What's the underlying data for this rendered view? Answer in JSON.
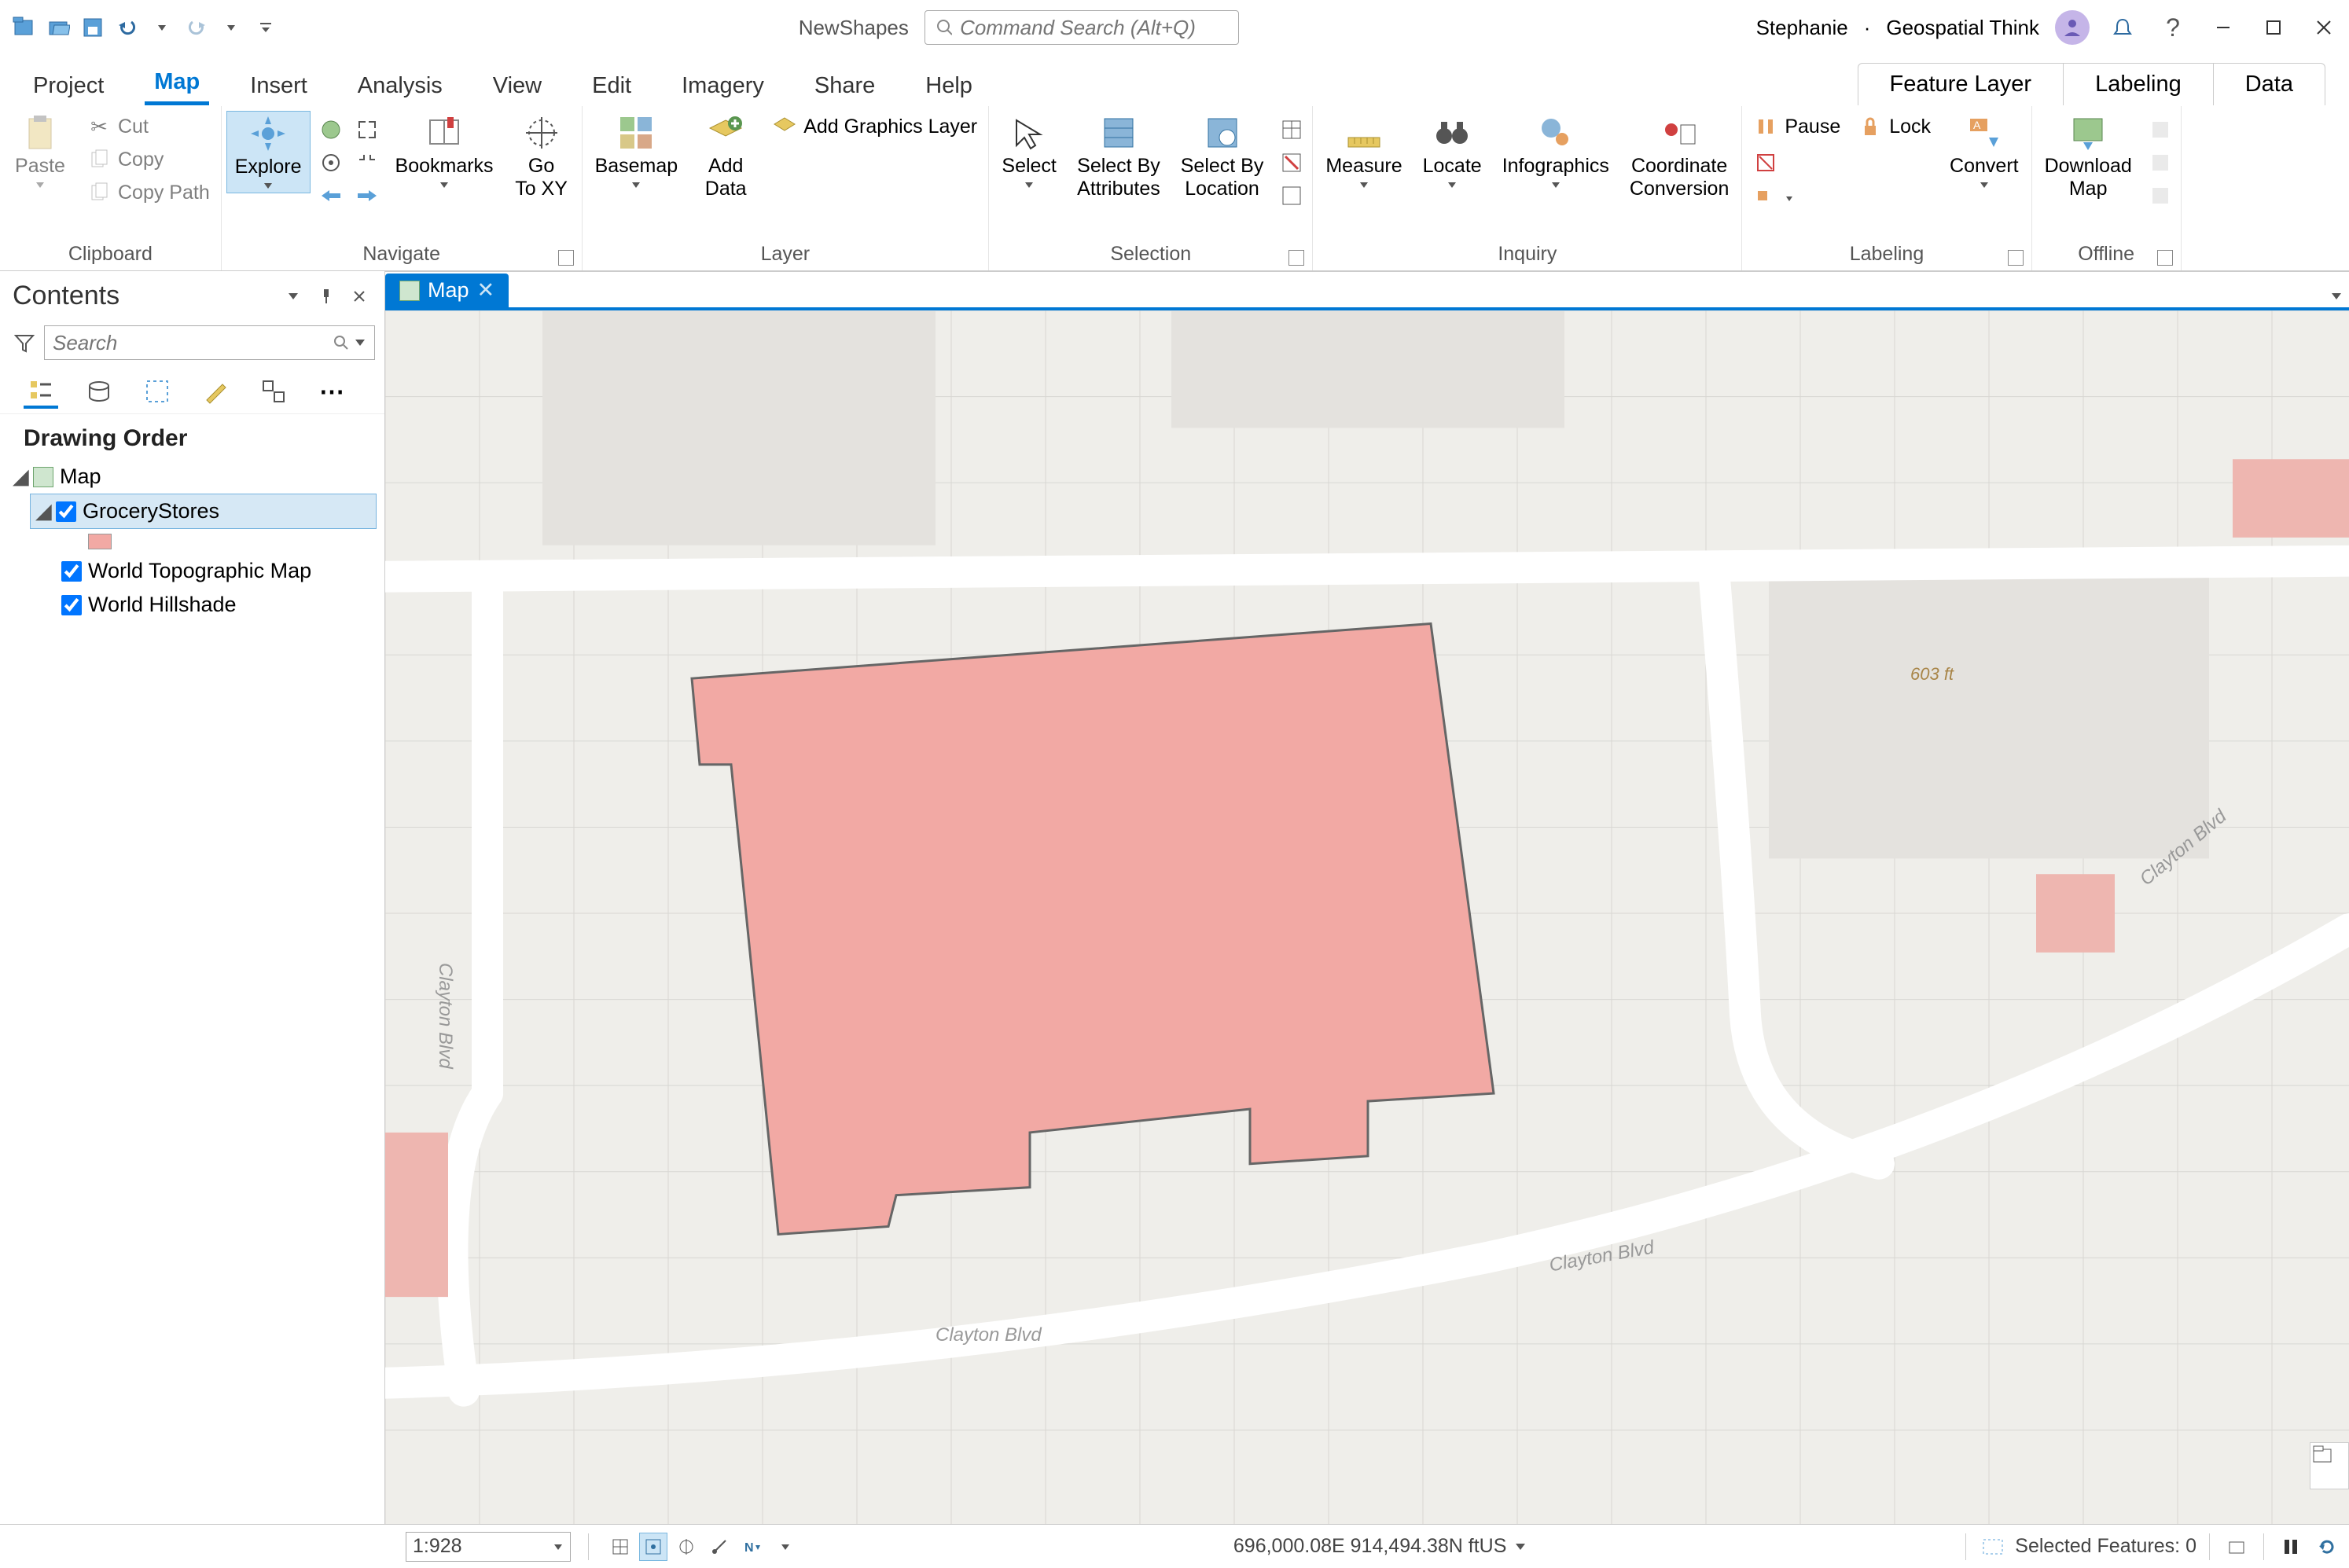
{
  "title_bar": {
    "project_name": "NewShapes",
    "command_search_placeholder": "Command Search (Alt+Q)",
    "user_name": "Stephanie",
    "org": "Geospatial Think"
  },
  "main_tabs": [
    "Project",
    "Map",
    "Insert",
    "Analysis",
    "View",
    "Edit",
    "Imagery",
    "Share",
    "Help"
  ],
  "active_main_tab": "Map",
  "context_tabs": [
    "Feature Layer",
    "Labeling",
    "Data"
  ],
  "ribbon": {
    "clipboard": {
      "title": "Clipboard",
      "paste": "Paste",
      "cut": "Cut",
      "copy": "Copy",
      "copy_path": "Copy Path"
    },
    "navigate": {
      "title": "Navigate",
      "explore": "Explore",
      "bookmarks": "Bookmarks",
      "goto_xy": "Go\nTo XY"
    },
    "layer": {
      "title": "Layer",
      "basemap": "Basemap",
      "add_data": "Add\nData",
      "add_graphics": "Add Graphics Layer"
    },
    "selection": {
      "title": "Selection",
      "select": "Select",
      "by_attr": "Select By\nAttributes",
      "by_loc": "Select By\nLocation"
    },
    "inquiry": {
      "title": "Inquiry",
      "measure": "Measure",
      "locate": "Locate",
      "infographics": "Infographics",
      "coord_conv": "Coordinate\nConversion"
    },
    "labeling": {
      "title": "Labeling",
      "pause": "Pause",
      "lock": "Lock",
      "convert": "Convert"
    },
    "offline": {
      "title": "Offline",
      "download_map": "Download\nMap"
    }
  },
  "contents": {
    "title": "Contents",
    "search_placeholder": "Search",
    "drawing_order_label": "Drawing Order",
    "map_node": "Map",
    "layers": [
      {
        "name": "GroceryStores",
        "checked": true,
        "selected": true,
        "has_swatch": true,
        "swatch_color": "#f2a9a4"
      },
      {
        "name": "World Topographic Map",
        "checked": true,
        "selected": false,
        "has_swatch": false
      },
      {
        "name": "World Hillshade",
        "checked": true,
        "selected": false,
        "has_swatch": false
      }
    ]
  },
  "map_view": {
    "tab_name": "Map",
    "streets": {
      "clayton_blvd": "Clayton Blvd"
    },
    "elevation_label": "603 ft"
  },
  "status_bar": {
    "scale": "1:928",
    "coords": "696,000.08E 914,494.38N ftUS",
    "selected_features": "Selected Features: 0"
  }
}
